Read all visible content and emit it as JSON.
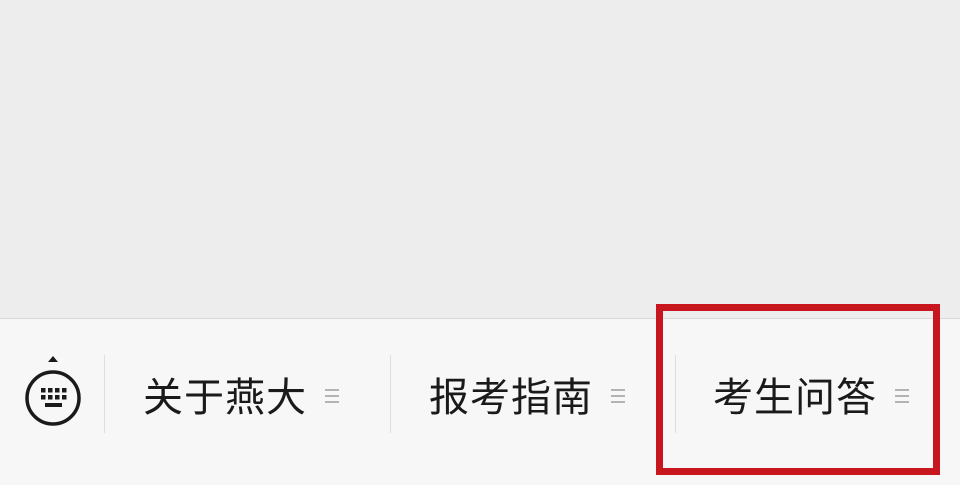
{
  "chat_area": {},
  "menu_bar": {
    "keyboard_icon": "keyboard-icon",
    "items": [
      {
        "label": "关于燕大",
        "icon": "menu-lines-icon"
      },
      {
        "label": "报考指南",
        "icon": "menu-lines-icon"
      },
      {
        "label": "考生问答",
        "icon": "menu-lines-icon"
      }
    ]
  },
  "highlight": {
    "color": "#c8161e"
  },
  "colors": {
    "chat_background": "#ededed",
    "menu_background": "#f7f7f7",
    "text": "#1a1a1a"
  }
}
